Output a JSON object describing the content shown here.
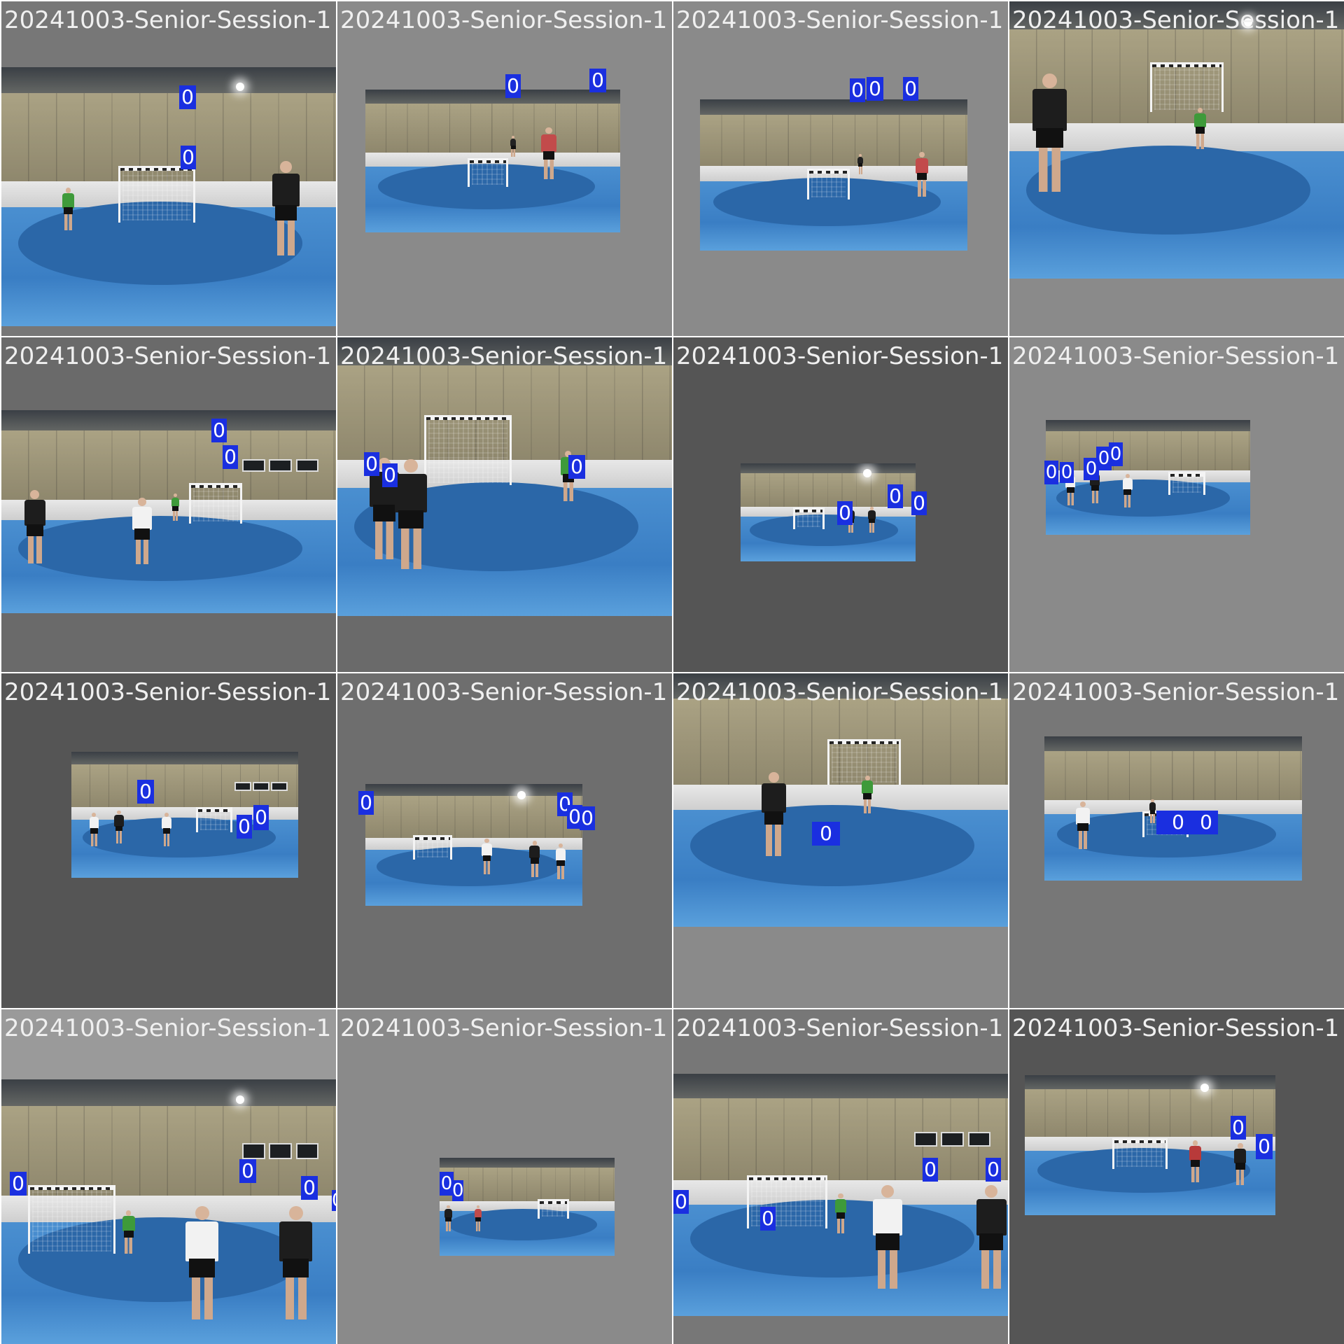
{
  "colors": {
    "border": "#ffffff",
    "box_fill": "#1a2fe0",
    "caption_text": "#f0f0f0"
  },
  "tiles": [
    {
      "caption": "20241003-Senior-Session-1",
      "bg": "#777777",
      "label": "0"
    },
    {
      "caption": "20241003-Senior-Session-1",
      "bg": "#8a8a8a",
      "label": "0"
    },
    {
      "caption": "20241003-Senior-Session-1",
      "bg": "#8a8a8a",
      "label": "0"
    },
    {
      "caption": "20241003-Senior-Session-1",
      "bg": "#8a8a8a",
      "label": "0"
    },
    {
      "caption": "20241003-Senior-Session-1",
      "bg": "#6a6a6a",
      "label": "0"
    },
    {
      "caption": "20241003-Senior-Session-1",
      "bg": "#6a6a6a",
      "label": "0"
    },
    {
      "caption": "20241003-Senior-Session-1",
      "bg": "#555555",
      "label": "0"
    },
    {
      "caption": "20241003-Senior-Session-1",
      "bg": "#8a8a8a",
      "label": "0"
    },
    {
      "caption": "20241003-Senior-Session-1",
      "bg": "#555555",
      "label": "0"
    },
    {
      "caption": "20241003-Senior-Session-1",
      "bg": "#6e6e6e",
      "label": "0"
    },
    {
      "caption": "20241003-Senior-Session-1",
      "bg": "#8a8a8a",
      "label": "0"
    },
    {
      "caption": "20241003-Senior-Session-1",
      "bg": "#777777",
      "label": "0"
    },
    {
      "caption": "20241003-Senior-Session-1",
      "bg": "#9a9a9a",
      "label": "0"
    },
    {
      "caption": "20241003-Senior-Session-1",
      "bg": "#8a8a8a",
      "label": "0"
    },
    {
      "caption": "20241003-Senior-Session-1",
      "bg": "#777777",
      "label": "0"
    },
    {
      "caption": "20241003-Senior-Session-1",
      "bg": "#555555",
      "label": "0"
    }
  ]
}
